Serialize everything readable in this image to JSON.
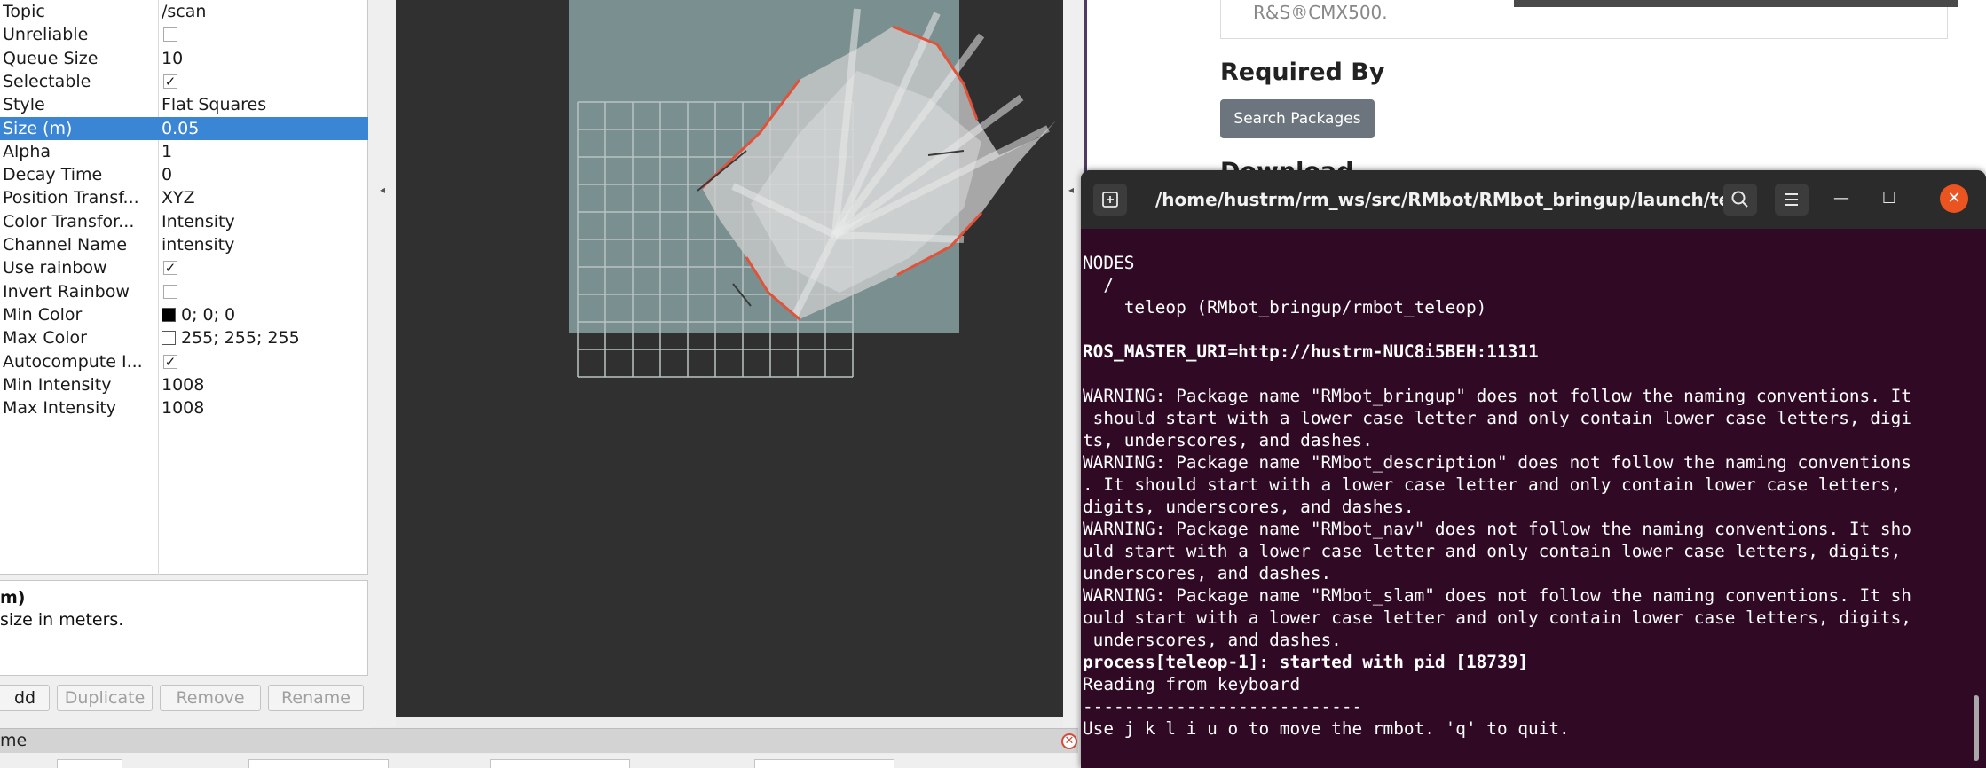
{
  "rviz": {
    "properties": [
      {
        "name": "Topic",
        "value": "/scan"
      },
      {
        "name": "Unreliable",
        "checked": false
      },
      {
        "name": "Queue Size",
        "value": "10"
      },
      {
        "name": "Selectable",
        "checked": true
      },
      {
        "name": "Style",
        "value": "Flat Squares"
      },
      {
        "name": "Size (m)",
        "value": "0.05"
      },
      {
        "name": "Alpha",
        "value": "1"
      },
      {
        "name": "Decay Time",
        "value": "0"
      },
      {
        "name": "Position Transf...",
        "value": "XYZ"
      },
      {
        "name": "Color Transfor...",
        "value": "Intensity"
      },
      {
        "name": "Channel Name",
        "value": "intensity"
      },
      {
        "name": "Use rainbow",
        "checked": true
      },
      {
        "name": "Invert Rainbow",
        "checked": false
      },
      {
        "name": "Min Color",
        "value": "0; 0; 0",
        "swatch": "#000000"
      },
      {
        "name": "Max Color",
        "value": "255; 255; 255",
        "swatch": "#ffffff"
      },
      {
        "name": "Autocompute I...",
        "checked": true
      },
      {
        "name": "Min Intensity",
        "value": "1008"
      },
      {
        "name": "Max Intensity",
        "value": "1008"
      }
    ],
    "selected_property": "Size (m)",
    "description_title": "m)",
    "description_text": " size in meters.",
    "buttons": {
      "add": "dd",
      "duplicate": "Duplicate",
      "remove": "Remove",
      "rename": "Rename"
    },
    "time_panel_label": "me",
    "check_glyph": "✓",
    "collapse_glyph": "◂"
  },
  "browser": {
    "cmx_text": "R&S®CMX500.",
    "required_by": "Required By",
    "search_button": "Search Packages",
    "download_heading": "Download"
  },
  "terminal": {
    "title": "/home/hustrm/rm_ws/src/RMbot/RMbot_bringup/launch/tel...",
    "lines": [
      {
        "text": "NODES",
        "bold": false
      },
      {
        "text": "  /",
        "bold": false
      },
      {
        "text": "    teleop (RMbot_bringup/rmbot_teleop)",
        "bold": false
      },
      {
        "text": "",
        "bold": false
      },
      {
        "text": "ROS_MASTER_URI=http://hustrm-NUC8i5BEH:11311",
        "bold": true
      },
      {
        "text": "",
        "bold": false
      },
      {
        "text": "WARNING: Package name \"RMbot_bringup\" does not follow the naming conventions. It",
        "bold": false
      },
      {
        "text": " should start with a lower case letter and only contain lower case letters, digi",
        "bold": false
      },
      {
        "text": "ts, underscores, and dashes.",
        "bold": false
      },
      {
        "text": "WARNING: Package name \"RMbot_description\" does not follow the naming conventions",
        "bold": false
      },
      {
        "text": ". It should start with a lower case letter and only contain lower case letters,",
        "bold": false
      },
      {
        "text": "digits, underscores, and dashes.",
        "bold": false
      },
      {
        "text": "WARNING: Package name \"RMbot_nav\" does not follow the naming conventions. It sho",
        "bold": false
      },
      {
        "text": "uld start with a lower case letter and only contain lower case letters, digits,",
        "bold": false
      },
      {
        "text": "underscores, and dashes.",
        "bold": false
      },
      {
        "text": "WARNING: Package name \"RMbot_slam\" does not follow the naming conventions. It sh",
        "bold": false
      },
      {
        "text": "ould start with a lower case letter and only contain lower case letters, digits,",
        "bold": false
      },
      {
        "text": " underscores, and dashes.",
        "bold": false
      },
      {
        "text": "process[teleop-1]: started with pid [18739]",
        "bold": true
      },
      {
        "text": "Reading from keyboard",
        "bold": false
      },
      {
        "text": "---------------------------",
        "bold": false
      },
      {
        "text": "Use j k l i u o to move the rmbot. 'q' to quit.",
        "bold": false
      }
    ]
  },
  "colors": {
    "selection": "#3b86d4",
    "terminal_bg": "#300a24",
    "close_orange": "#e95420",
    "map_floor": "#7a8f8f",
    "viewport_bg": "#303030"
  }
}
